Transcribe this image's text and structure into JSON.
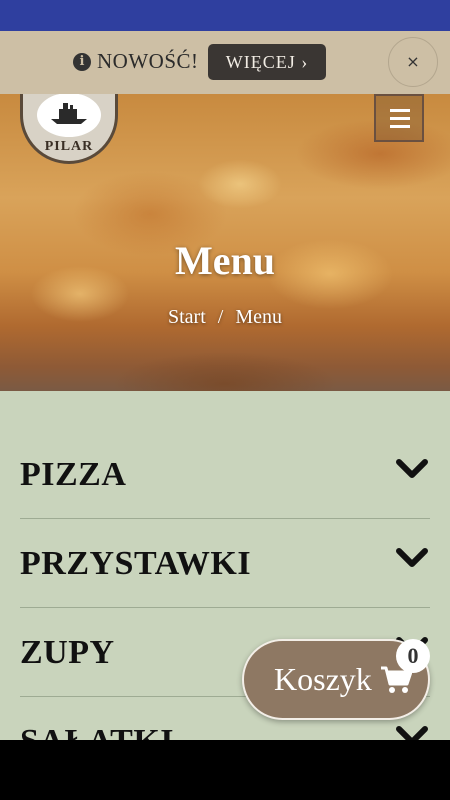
{
  "promo": {
    "text": "NOWOŚĆ!",
    "button_label": "WIĘCEJ ›",
    "close_label": "×"
  },
  "logo": {
    "text": "PILAR"
  },
  "hero": {
    "title": "Menu",
    "breadcrumb": [
      "Start",
      "/",
      "Menu"
    ]
  },
  "categories": [
    {
      "label": "PIZZA"
    },
    {
      "label": "PRZYSTAWKI"
    },
    {
      "label": "ZUPY"
    },
    {
      "label": "SAŁATKI"
    }
  ],
  "cart": {
    "label": "Koszyk",
    "count": "0"
  },
  "colors": {
    "status_bar": "#2f3f9f",
    "promo_bg": "#cdbfa5",
    "content_bg": "#c9d4bc",
    "cart_bg": "#8e7863"
  }
}
